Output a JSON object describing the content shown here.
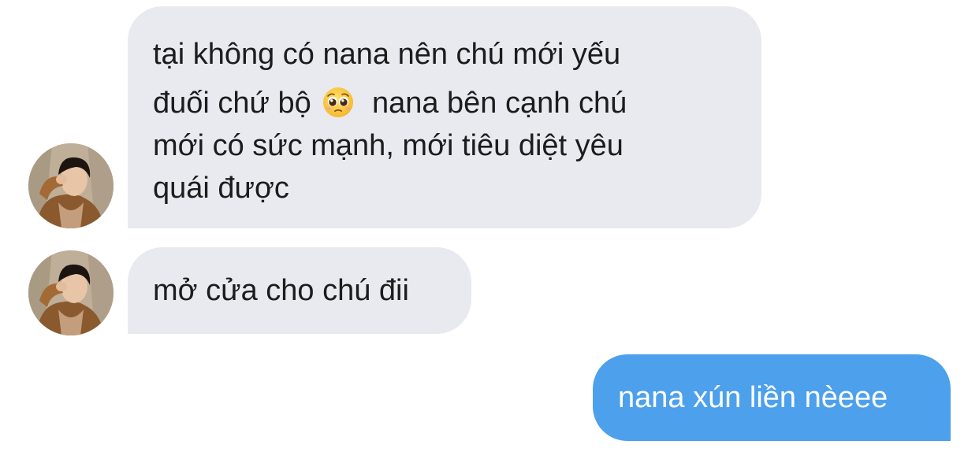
{
  "conversation": {
    "messages": [
      {
        "sender": "other",
        "lines": [
          "tại không có nana nên chú mới yếu",
          "đuối chứ bộ",
          "nana bên cạnh chú",
          "mới có sức mạnh, mới tiêu diệt yêu",
          "quái được"
        ],
        "emoji": "pleading-face-emoji"
      },
      {
        "sender": "other",
        "lines": [
          "mở cửa cho chú đii"
        ]
      },
      {
        "sender": "me",
        "lines": [
          "nana xún liền nèeee"
        ]
      }
    ]
  },
  "theme": {
    "incoming_bubble_color": "#e8eaef",
    "outgoing_bubble_color": "#4ca0ec",
    "incoming_text_color": "#1c1c1e",
    "outgoing_text_color": "#ffffff"
  },
  "icons": {
    "avatar": "contact-avatar-photo",
    "emoji": "pleading-face-emoji"
  }
}
